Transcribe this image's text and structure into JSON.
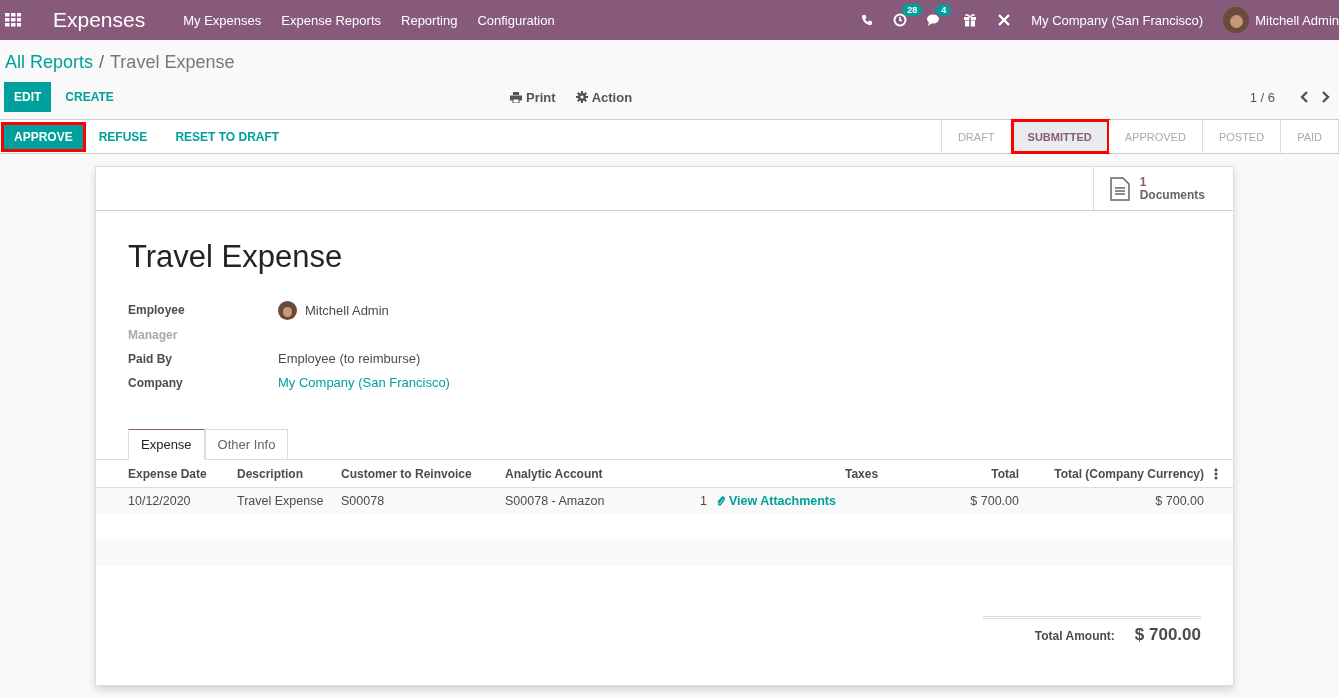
{
  "navbar": {
    "app_title": "Expenses",
    "menu": [
      "My Expenses",
      "Expense Reports",
      "Reporting",
      "Configuration"
    ],
    "activity_count": "28",
    "message_count": "4",
    "company": "My Company (San Francisco)",
    "user": "Mitchell Admin"
  },
  "breadcrumb": {
    "parent": "All Reports",
    "separator": "/",
    "current": "Travel Expense"
  },
  "control_panel": {
    "edit": "EDIT",
    "create": "CREATE",
    "print": "Print",
    "action": "Action",
    "pager": "1 / 6"
  },
  "actions": [
    {
      "label": "APPROVE",
      "primary": true,
      "highlighted": true
    },
    {
      "label": "REFUSE",
      "primary": false,
      "highlighted": false
    },
    {
      "label": "RESET TO DRAFT",
      "primary": false,
      "highlighted": false
    }
  ],
  "stages": [
    {
      "label": "DRAFT",
      "selected": false,
      "highlighted": false
    },
    {
      "label": "SUBMITTED",
      "selected": true,
      "highlighted": true
    },
    {
      "label": "APPROVED",
      "selected": false,
      "highlighted": false
    },
    {
      "label": "POSTED",
      "selected": false,
      "highlighted": false
    },
    {
      "label": "PAID",
      "selected": false,
      "highlighted": false
    }
  ],
  "smart_button": {
    "count": "1",
    "label": "Documents"
  },
  "title": "Travel Expense",
  "fields": [
    {
      "label": "Employee",
      "value": "Mitchell Admin",
      "kind": "avatar",
      "muted": false
    },
    {
      "label": "Manager",
      "kind": "empty",
      "muted": true
    },
    {
      "label": "Paid By",
      "value": "Employee (to reimburse)",
      "kind": "text",
      "muted": false
    },
    {
      "label": "Company",
      "value": "My Company (San Francisco)",
      "kind": "link",
      "muted": false
    }
  ],
  "tabs": [
    {
      "label": "Expense",
      "selected": true
    },
    {
      "label": "Other Info",
      "selected": false
    }
  ],
  "table": {
    "columns": [
      "Expense Date",
      "Description",
      "Customer to Reinvoice",
      "Analytic Account",
      "Taxes",
      "Total",
      "Total (Company Currency)"
    ],
    "rows": [
      {
        "expense_date": "10/12/2020",
        "description": "Travel Expense",
        "customer": "S00078",
        "analytic_account": "S00078 - Amazon",
        "column_5": "1",
        "attachments": "View Attachments",
        "total": "$ 700.00",
        "total_company": "$ 700.00"
      }
    ]
  },
  "total": {
    "label": "Total Amount:",
    "value": "$ 700.00"
  }
}
